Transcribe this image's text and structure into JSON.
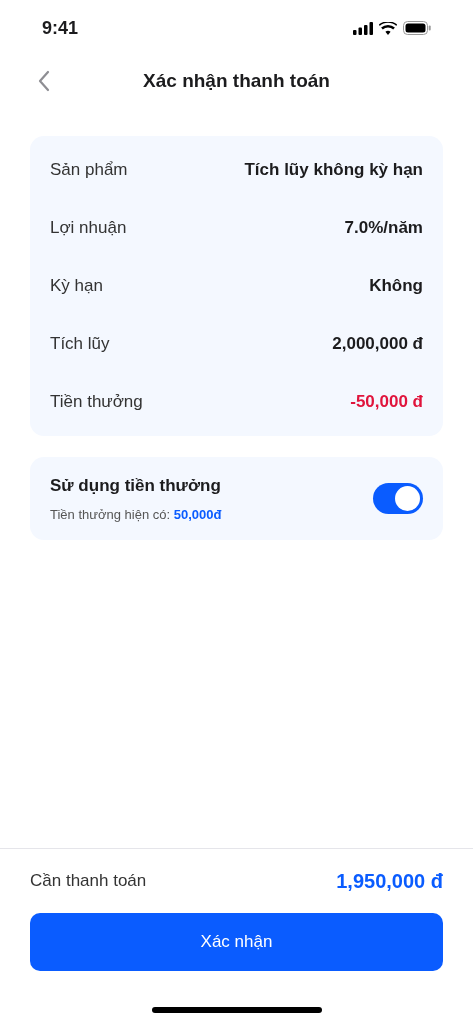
{
  "status_bar": {
    "time": "9:41"
  },
  "header": {
    "title": "Xác nhận thanh toán"
  },
  "details": [
    {
      "label": "Sản phẩm",
      "value": "Tích lũy không kỳ hạn",
      "negative": false
    },
    {
      "label": "Lợi nhuận",
      "value": "7.0%/năm",
      "negative": false
    },
    {
      "label": "Kỳ hạn",
      "value": "Không",
      "negative": false
    },
    {
      "label": "Tích lũy",
      "value": "2,000,000 đ",
      "negative": false
    },
    {
      "label": "Tiền thưởng",
      "value": "-50,000 đ",
      "negative": true
    }
  ],
  "bonus": {
    "title": "Sử dụng tiền thưởng",
    "available_label": "Tiền thưởng hiện có:",
    "available_amount": "50,000đ",
    "on": true
  },
  "footer": {
    "total_label": "Cần thanh toán",
    "total_value": "1,950,000 đ",
    "confirm_button": "Xác nhận"
  }
}
